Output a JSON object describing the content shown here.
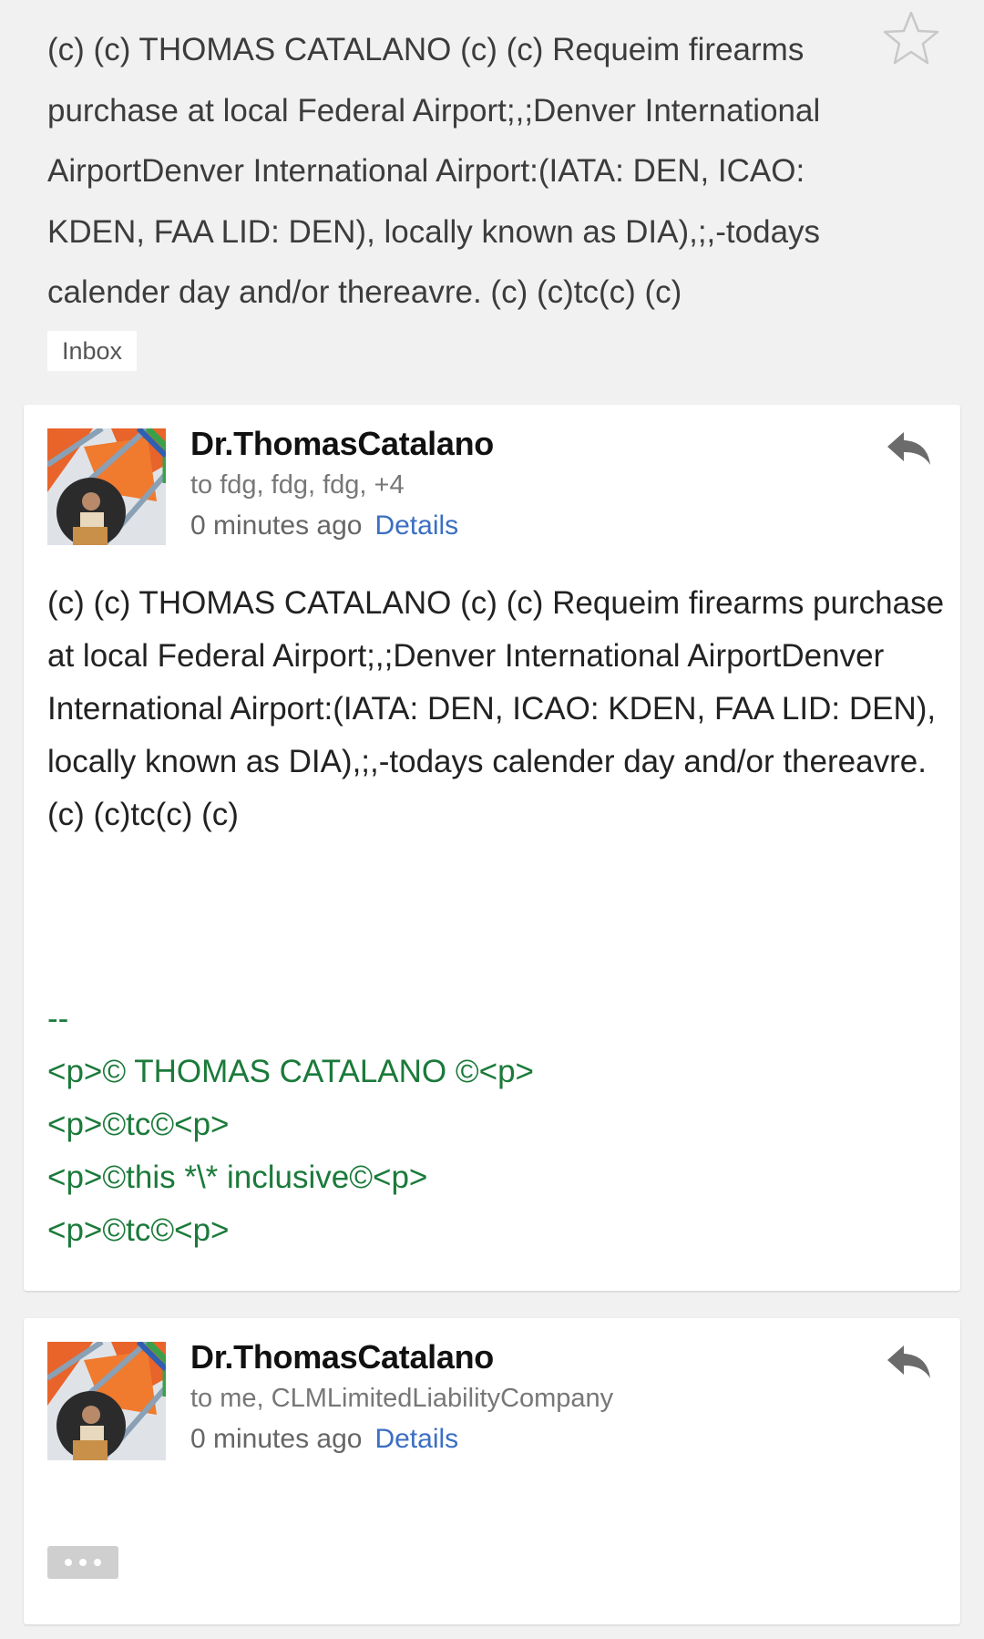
{
  "thread": {
    "subject": "(c) (c) THOMAS CATALANO (c) (c) Requeim firearms purchase at local Federal Airport;,;Denver International AirportDenver International Airport:(IATA: DEN, ICAO: KDEN, FAA LID: DEN), locally known as DIA),;,-todays calender day and/or thereavre. (c) (c)tc(c) (c)",
    "label": "Inbox",
    "starred": false
  },
  "messages": [
    {
      "sender": "Dr.ThomasCatalano",
      "recipients": "to fdg, fdg, fdg, +4",
      "time": "0 minutes ago",
      "details_label": "Details",
      "body": "(c) (c) THOMAS CATALANO (c) (c) Requeim firearms purchase at local Federal Airport;,;Denver International AirportDenver International Airport:(IATA: DEN, ICAO: KDEN, FAA LID: DEN), locally known as DIA),;,-todays calender day and/or thereavre. (c) (c)tc(c) (c)",
      "signature": "--\n<p>© THOMAS CATALANO ©<p>\n<p>©tc©<p>\n<p>©this *\\* inclusive©<p>\n<p>©tc©<p>"
    },
    {
      "sender": "Dr.ThomasCatalano",
      "recipients": "to me, CLMLimitedLiabilityCompany",
      "time": "0 minutes ago",
      "details_label": "Details"
    }
  ],
  "icons": {
    "star": "star-outline-icon",
    "reply": "reply-arrow-icon",
    "more": "ellipsis-icon"
  },
  "colors": {
    "link": "#3b6fc2",
    "signature": "#1b7a3a",
    "background": "#f1f1f1"
  }
}
